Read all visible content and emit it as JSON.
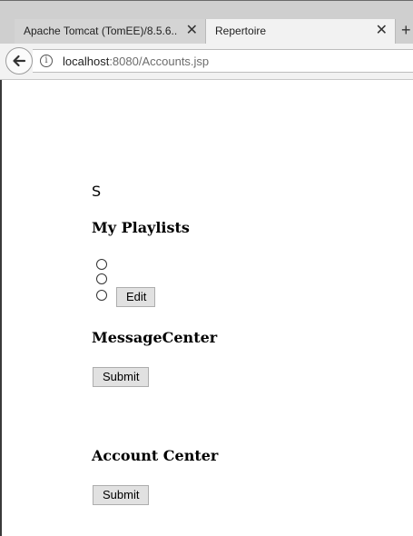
{
  "browser": {
    "tabs": [
      {
        "label": "Apache Tomcat (TomEE)/8.5.6...",
        "active": false
      },
      {
        "label": "Repertoire",
        "active": true
      }
    ],
    "new_tab_icon": "plus-icon",
    "close_icon": "close-icon",
    "url_host": "localhost",
    "url_rest": ":8080/Accounts.jsp"
  },
  "page": {
    "user_initial": "S",
    "playlists": {
      "heading": "My Playlists",
      "edit_label": "Edit"
    },
    "message_center": {
      "heading": "MessageCenter",
      "submit_label": "Submit"
    },
    "account_center": {
      "heading": "Account Center",
      "submit_label": "Submit"
    }
  }
}
